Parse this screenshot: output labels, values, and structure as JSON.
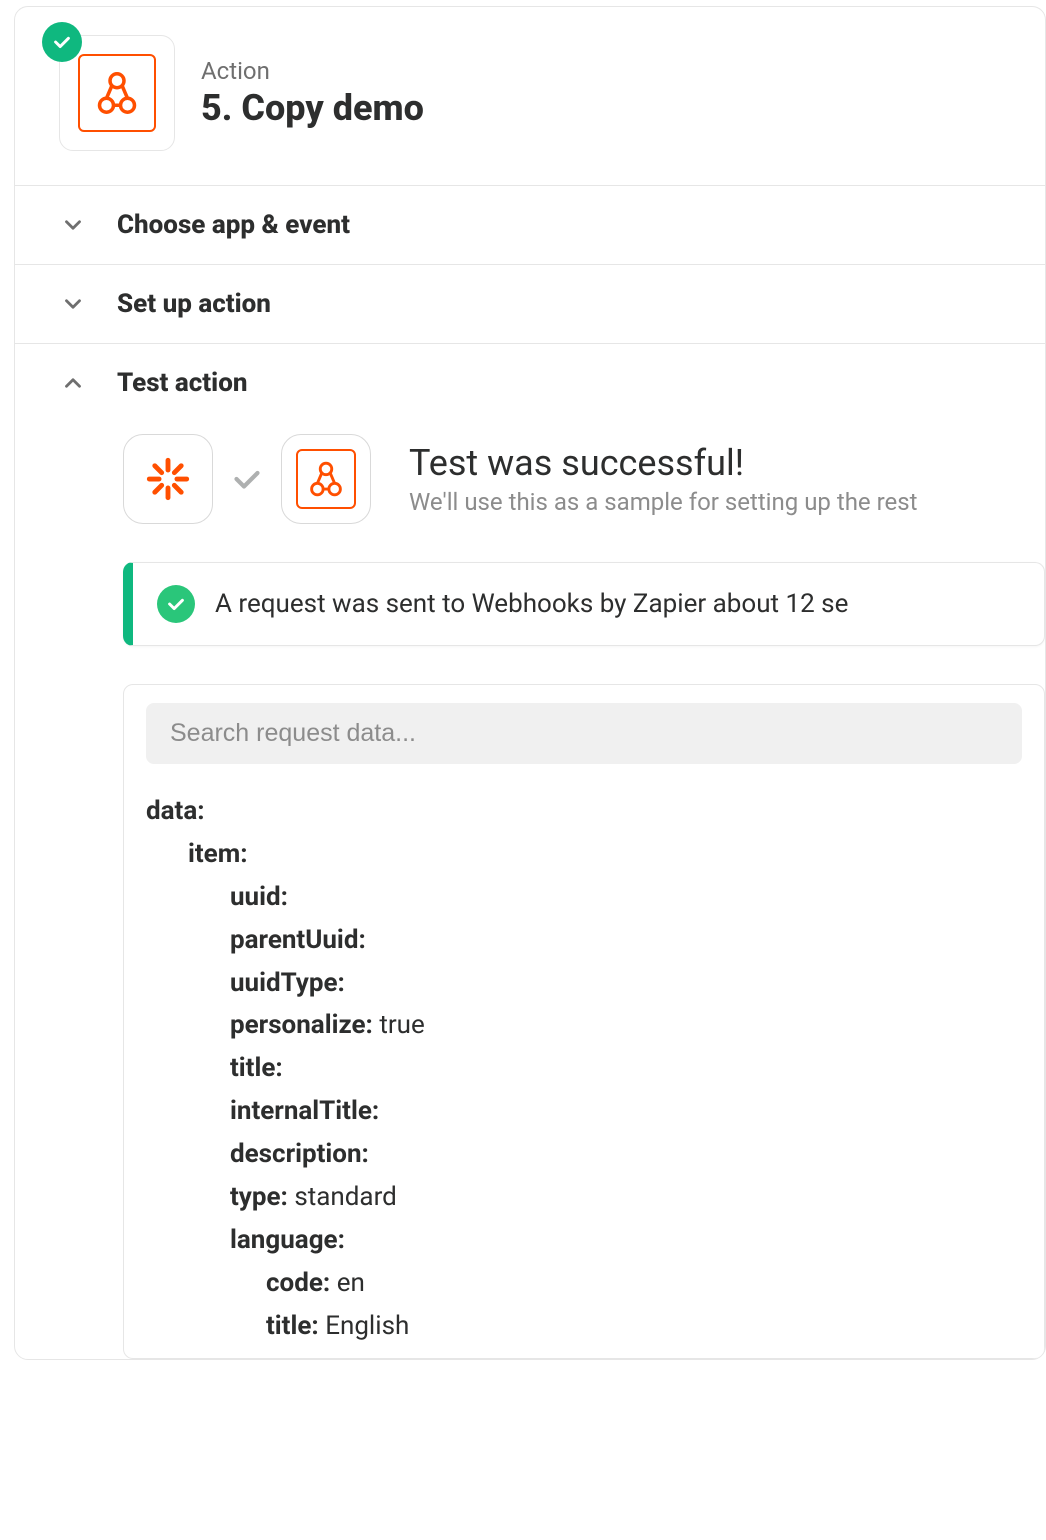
{
  "header": {
    "label": "Action",
    "title": "5. Copy demo"
  },
  "sections": {
    "choose": "Choose app & event",
    "setup": "Set up action",
    "test": "Test action"
  },
  "test": {
    "heading": "Test was successful!",
    "subheading": "We'll use this as a sample for setting up the rest",
    "banner": "A request was sent to Webhooks by Zapier about 12 se",
    "search_placeholder": "Search request data..."
  },
  "tree": {
    "root": "data:",
    "item": "item:",
    "uuid": "uuid:",
    "uuid_val": "",
    "parentUuid": "parentUuid:",
    "parentUuid_val": "",
    "uuidType": "uuidType:",
    "uuidType_val": "",
    "personalize": "personalize:",
    "personalize_val": "true",
    "title": "title:",
    "title_val": "",
    "internalTitle": "internalTitle:",
    "internalTitle_val": "",
    "description": "description:",
    "description_val": "",
    "type": "type:",
    "type_val": "standard",
    "language": "language:",
    "lang_code": "code:",
    "lang_code_val": "en",
    "lang_title": "title:",
    "lang_title_val": "English"
  }
}
